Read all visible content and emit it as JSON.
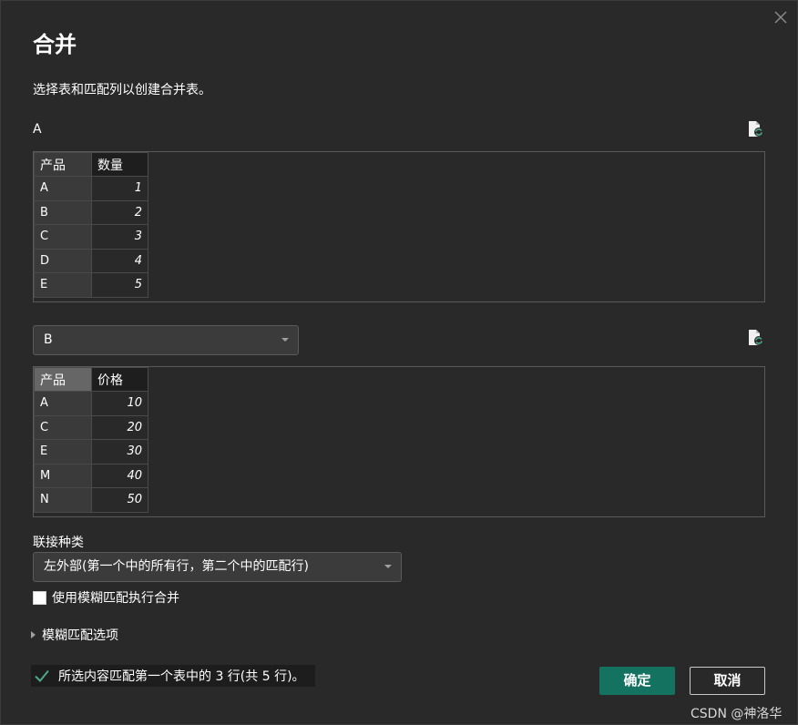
{
  "dialog": {
    "title": "合并",
    "subtitle": "选择表和匹配列以创建合并表。",
    "close_icon": "close-icon"
  },
  "table_a": {
    "label": "A",
    "refresh_icon": "document-refresh-icon",
    "headers": [
      "产品",
      "数量"
    ],
    "rows": [
      [
        "A",
        "1"
      ],
      [
        "B",
        "2"
      ],
      [
        "C",
        "3"
      ],
      [
        "D",
        "4"
      ],
      [
        "E",
        "5"
      ]
    ]
  },
  "table_b": {
    "selected": "B",
    "refresh_icon": "document-refresh-icon",
    "headers": [
      "产品",
      "价格"
    ],
    "rows": [
      [
        "A",
        "10"
      ],
      [
        "C",
        "20"
      ],
      [
        "E",
        "30"
      ],
      [
        "M",
        "40"
      ],
      [
        "N",
        "50"
      ]
    ]
  },
  "join": {
    "label": "联接种类",
    "selected": "左外部(第一个中的所有行，第二个中的匹配行)"
  },
  "fuzzy": {
    "checkbox_label": "使用模糊匹配执行合并",
    "checked": false,
    "options_label": "模糊匹配选项"
  },
  "status": {
    "icon": "checkmark-icon",
    "text": "所选内容匹配第一个表中的 3 行(共 5 行)。"
  },
  "buttons": {
    "ok": "确定",
    "cancel": "取消"
  },
  "colors": {
    "accent": "#137360",
    "background": "#292929",
    "check_green": "#4fa88c"
  },
  "watermark": "CSDN @神洛华"
}
